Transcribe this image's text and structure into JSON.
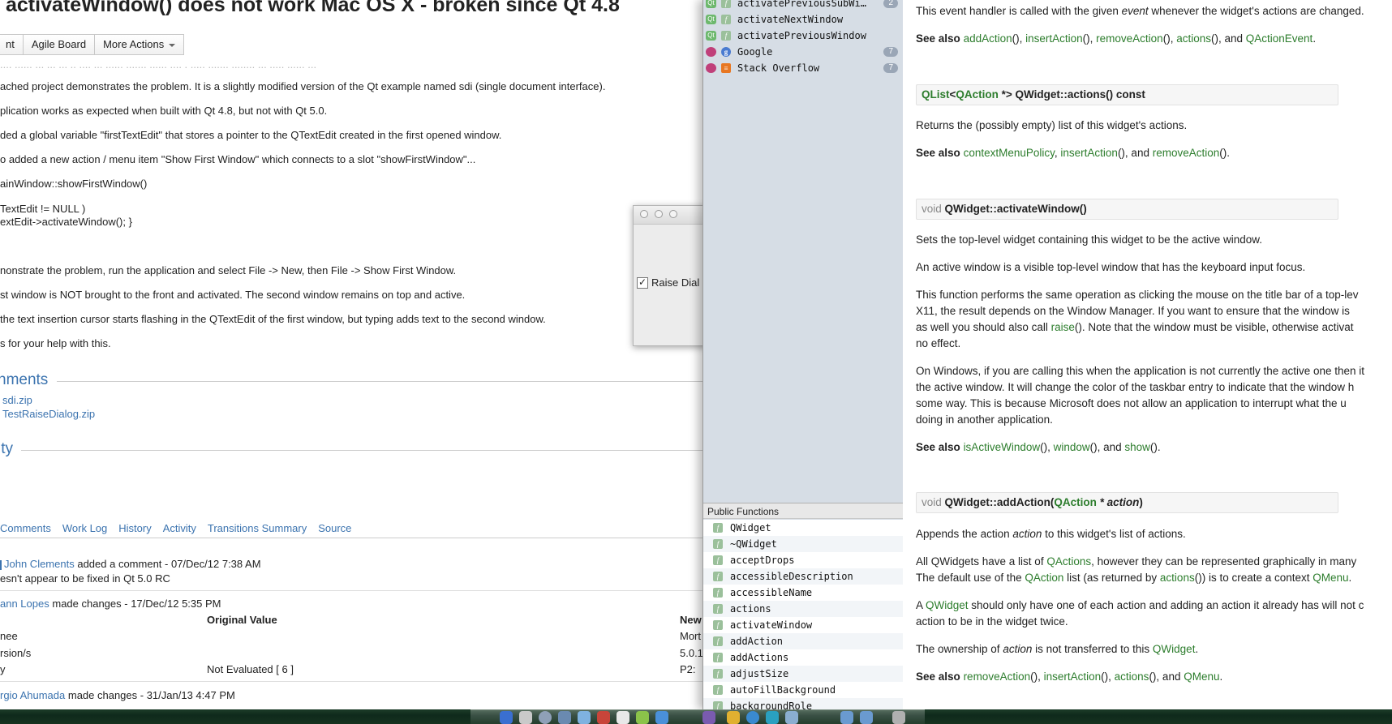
{
  "issue": {
    "title": "activateWindow() does not work Mac OS X - broken since Qt 4.8",
    "actions": {
      "button_1": "nt",
      "button_2": "Agile Board",
      "button_3": "More Actions"
    },
    "description_lines": [
      "ached project demonstrates the problem. It is a slightly modified version of the Qt example named sdi (single document interface).",
      "plication works as expected when built with Qt 4.8, but not with Qt 5.0.",
      "ded a global variable \"firstTextEdit\" that stores a pointer to the QTextEdit created in the first opened window.",
      "o added a new action / menu item \"Show First Window\" which connects to a slot \"showFirstWindow\"...",
      "ainWindow::showFirstWindow()",
      "TextEdit != NULL )",
      "extEdit->activateWindow(); }",
      "nonstrate the problem, run the application and select File -> New, then File -> Show First Window.",
      "st window is NOT brought to the front and activated. The second window remains on top and active.",
      "the text insertion cursor starts flashing in the QTextEdit of the first window, but typing adds text to the second window.",
      "s for your help with this."
    ],
    "attachments_heading": "hments",
    "attachments": [
      "sdi.zip",
      "TestRaiseDialog.zip"
    ],
    "activity_heading": "ity",
    "tabs": [
      "Comments",
      "Work Log",
      "History",
      "Activity",
      "Transitions Summary",
      "Source"
    ],
    "activity": {
      "comment_user": "John Clements",
      "comment_meta": "added a comment - 07/Dec/12 7:38 AM",
      "comment_text": "esn't appear to be fixed in Qt 5.0 RC",
      "change1_user": "ann Lopes",
      "change1_meta": "made changes - 17/Dec/12 5:35 PM",
      "col_original": "Original Value",
      "col_new": "New",
      "rows": [
        {
          "field": "nee",
          "original": "",
          "new": "Mort"
        },
        {
          "field": "rsion/s",
          "original": "",
          "new": "5.0.1"
        },
        {
          "field": "y",
          "original": "Not Evaluated [ 6 ]",
          "new": "P2:"
        }
      ],
      "change2_user": "rgio Ahumada",
      "change2_meta": "made changes - 31/Jan/13 4:47 PM"
    }
  },
  "dialog": {
    "checkbox_label": "Raise Dial",
    "checked": true
  },
  "assistant": {
    "bookmarks": [
      {
        "badge": "Qt",
        "name": "activatePreviousSubWi…",
        "count": "2",
        "badge_color": "#6db86d"
      },
      {
        "badge": "Qt",
        "name": "activateNextWindow",
        "count": "",
        "badge_color": "#6db86d"
      },
      {
        "badge": "Qt",
        "name": "activatePreviousWindow",
        "count": "",
        "badge_color": "#6db86d"
      },
      {
        "badge": "",
        "name": "Google",
        "count": "7",
        "badge_color": "#c0407a"
      },
      {
        "badge": "",
        "name": "Stack Overflow",
        "count": "7",
        "badge_color": "#c0407a"
      }
    ],
    "public_functions_header": "Public Functions",
    "public_functions": [
      "QWidget",
      "~QWidget",
      "acceptDrops",
      "accessibleDescription",
      "accessibleName",
      "actions",
      "activateWindow",
      "addAction",
      "addActions",
      "adjustSize",
      "autoFillBackground",
      "backgroundRole"
    ]
  },
  "doc": {
    "actionEvent_desc_pre": "This event handler is called with the given ",
    "actionEvent_desc_em": "event",
    "actionEvent_desc_post": " whenever the widget's actions are changed.",
    "see_also_label": "See also",
    "see_also_1": [
      "addAction",
      "insertAction",
      "removeAction",
      "actions",
      "QActionEvent"
    ],
    "sig_actions": {
      "type_a": "QList",
      "type_b": "QAction",
      "rest": " *> QWidget::actions() const"
    },
    "actions_desc": "Returns the (possibly empty) list of this widget's actions.",
    "see_also_2": [
      "contextMenuPolicy",
      "insertAction",
      "removeAction"
    ],
    "sig_activate": {
      "type": "void",
      "name": "QWidget::activateWindow()"
    },
    "activate_p1": "Sets the top-level widget containing this widget to be the active window.",
    "activate_p2": "An active window is a visible top-level window that has the keyboard input focus.",
    "activate_p3_lines": [
      "This function performs the same operation as clicking the mouse on the title bar of a top-lev",
      "X11, the result depends on the Window Manager. If you want to ensure that the window is",
      "as well you should also call ",
      "no effect."
    ],
    "activate_p3_raise": "raise",
    "activate_p3_tail": "(). Note that the window must be visible, otherwise activat",
    "activate_p4_lines": [
      "On Windows, if you are calling this when the application is not currently the active one then it",
      "the active window. It will change the color of the taskbar entry to indicate that the window h",
      "some way. This is because Microsoft does not allow an application to interrupt what the u",
      "doing in another application."
    ],
    "see_also_3": [
      "isActiveWindow",
      "window",
      "show"
    ],
    "sig_addAction": {
      "type": "void",
      "name": "QWidget::addAction(",
      "param_type": "QAction",
      "param": " * action",
      "close": ")"
    },
    "add_p1_pre": "Appends the action ",
    "add_p1_em": "action",
    "add_p1_post": " to this widget's list of actions.",
    "add_p2_line1_pre": "All QWidgets have a list of ",
    "add_p2_line1_link": "QActions",
    "add_p2_line1_post": ", however they can be represented graphically in many",
    "add_p2_line2_pre": "The default use of the ",
    "add_p2_line2_link1": "QAction",
    "add_p2_line2_mid": " list (as returned by ",
    "add_p2_line2_link2": "actions",
    "add_p2_line2_mid2": "()) is to create a context ",
    "add_p2_line2_link3": "QMenu",
    "add_p2_line2_end": ".",
    "add_p3_line1_pre": "A ",
    "add_p3_line1_link": "QWidget",
    "add_p3_line1_post": " should only have one of each action and adding an action it already has will not c",
    "add_p3_line2": "action to be in the widget twice.",
    "add_p4_pre": "The ownership of ",
    "add_p4_em": "action",
    "add_p4_mid": " is not transferred to this ",
    "add_p4_link": "QWidget",
    "add_p4_end": ".",
    "see_also_4": [
      "removeAction",
      "insertAction",
      "actions",
      "QMenu"
    ]
  },
  "colors": {
    "link_blue": "#3b73af",
    "doc_link_green": "#2d7d2d",
    "panel_bg": "#d6dde5"
  }
}
